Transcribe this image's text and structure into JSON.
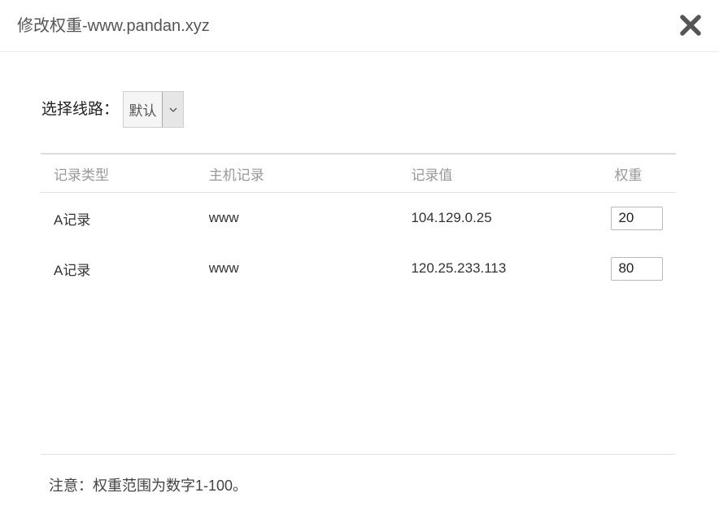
{
  "dialog": {
    "title": "修改权重-www.pandan.xyz",
    "close_icon": "close-icon"
  },
  "route": {
    "label": "选择线路：",
    "selected": "默认",
    "arrow_icon": "chevron-down-icon"
  },
  "table": {
    "headers": {
      "type": "记录类型",
      "host": "主机记录",
      "value": "记录值",
      "weight": "权重"
    },
    "rows": [
      {
        "type": "A记录",
        "host": "www",
        "value": "104.129.0.25",
        "weight": "20"
      },
      {
        "type": "A记录",
        "host": "www",
        "value": "120.25.233.113",
        "weight": "80"
      }
    ]
  },
  "footer": {
    "note": "注意：权重范围为数字1-100。"
  },
  "colors": {
    "title_text": "#555555",
    "close_icon": "#555555",
    "header_text": "#999999",
    "border": "#e2e2e2"
  }
}
